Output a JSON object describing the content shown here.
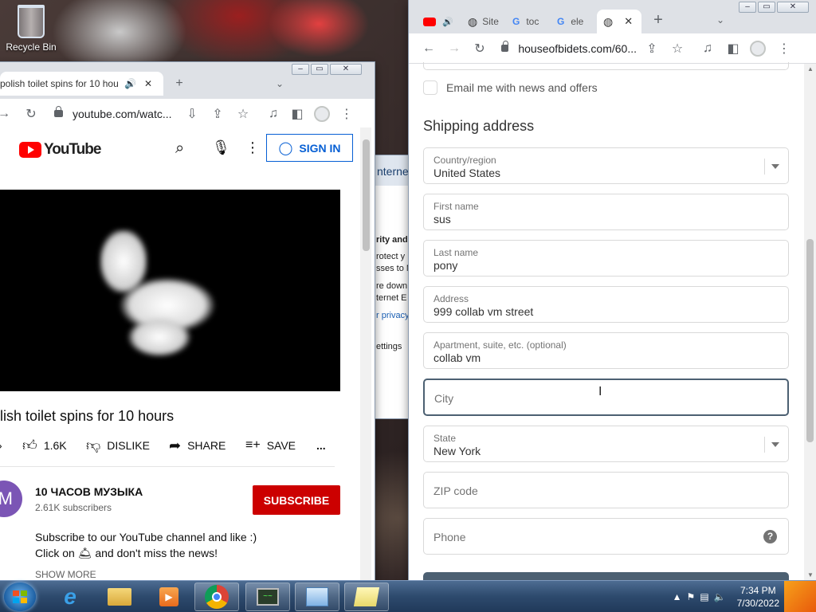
{
  "desktop": {
    "recycle_bin": "Recycle Bin"
  },
  "youtube_window": {
    "tab_title": "polish toilet spins for 10 hou",
    "url": "youtube.com/watc...",
    "header": {
      "logo_text": "YouTube",
      "signin_label": "SIGN IN"
    },
    "video_title": "lish toilet spins for 10 hours",
    "actions": {
      "like_count": "1.6K",
      "dislike_label": "DISLIKE",
      "share_label": "SHARE",
      "save_label": "SAVE",
      "more": "..."
    },
    "channel": {
      "avatar_letter": "M",
      "name": "10 ЧАСОВ МУЗЫКА",
      "subscribers": "2.61K subscribers",
      "subscribe_label": "SUBSCRIBE"
    },
    "description": {
      "line1": "Subscribe to our YouTube channel and like :)",
      "line2_prefix": "Click on",
      "line2_suffix": "and don't miss the news!",
      "show_more": "SHOW MORE"
    }
  },
  "middle_window": {
    "bar_text": "nterne",
    "lines": [
      "rity and",
      "rotect y",
      "sses to M",
      "re down",
      "ternet E",
      "r privacy",
      "ettings"
    ]
  },
  "checkout_window": {
    "tabs": [
      {
        "label": "Site"
      },
      {
        "label": "toc"
      },
      {
        "label": "ele"
      }
    ],
    "url": "houseofbidets.com/60...",
    "email_optin_label": "Email me with news and offers",
    "section_title": "Shipping address",
    "fields": {
      "country": {
        "label": "Country/region",
        "value": "United States"
      },
      "first_name": {
        "label": "First name",
        "value": "sus"
      },
      "last_name": {
        "label": "Last name",
        "value": "pony"
      },
      "address": {
        "label": "Address",
        "value": "999 collab vm street"
      },
      "apartment": {
        "label": "Apartment, suite, etc. (optional)",
        "value": "collab vm"
      },
      "city": {
        "placeholder": "City"
      },
      "state": {
        "label": "State",
        "value": "New York"
      },
      "zip": {
        "placeholder": "ZIP code"
      },
      "phone": {
        "placeholder": "Phone",
        "help": "?"
      }
    }
  },
  "taskbar": {
    "time": "7:34 PM",
    "date": "7/30/2022"
  },
  "colors": {
    "youtube_red": "#ff0000",
    "subscribe_red": "#cc0000",
    "signin_blue": "#065fd4",
    "focus_border": "#4c6072",
    "channel_avatar": "#7b55b5"
  }
}
